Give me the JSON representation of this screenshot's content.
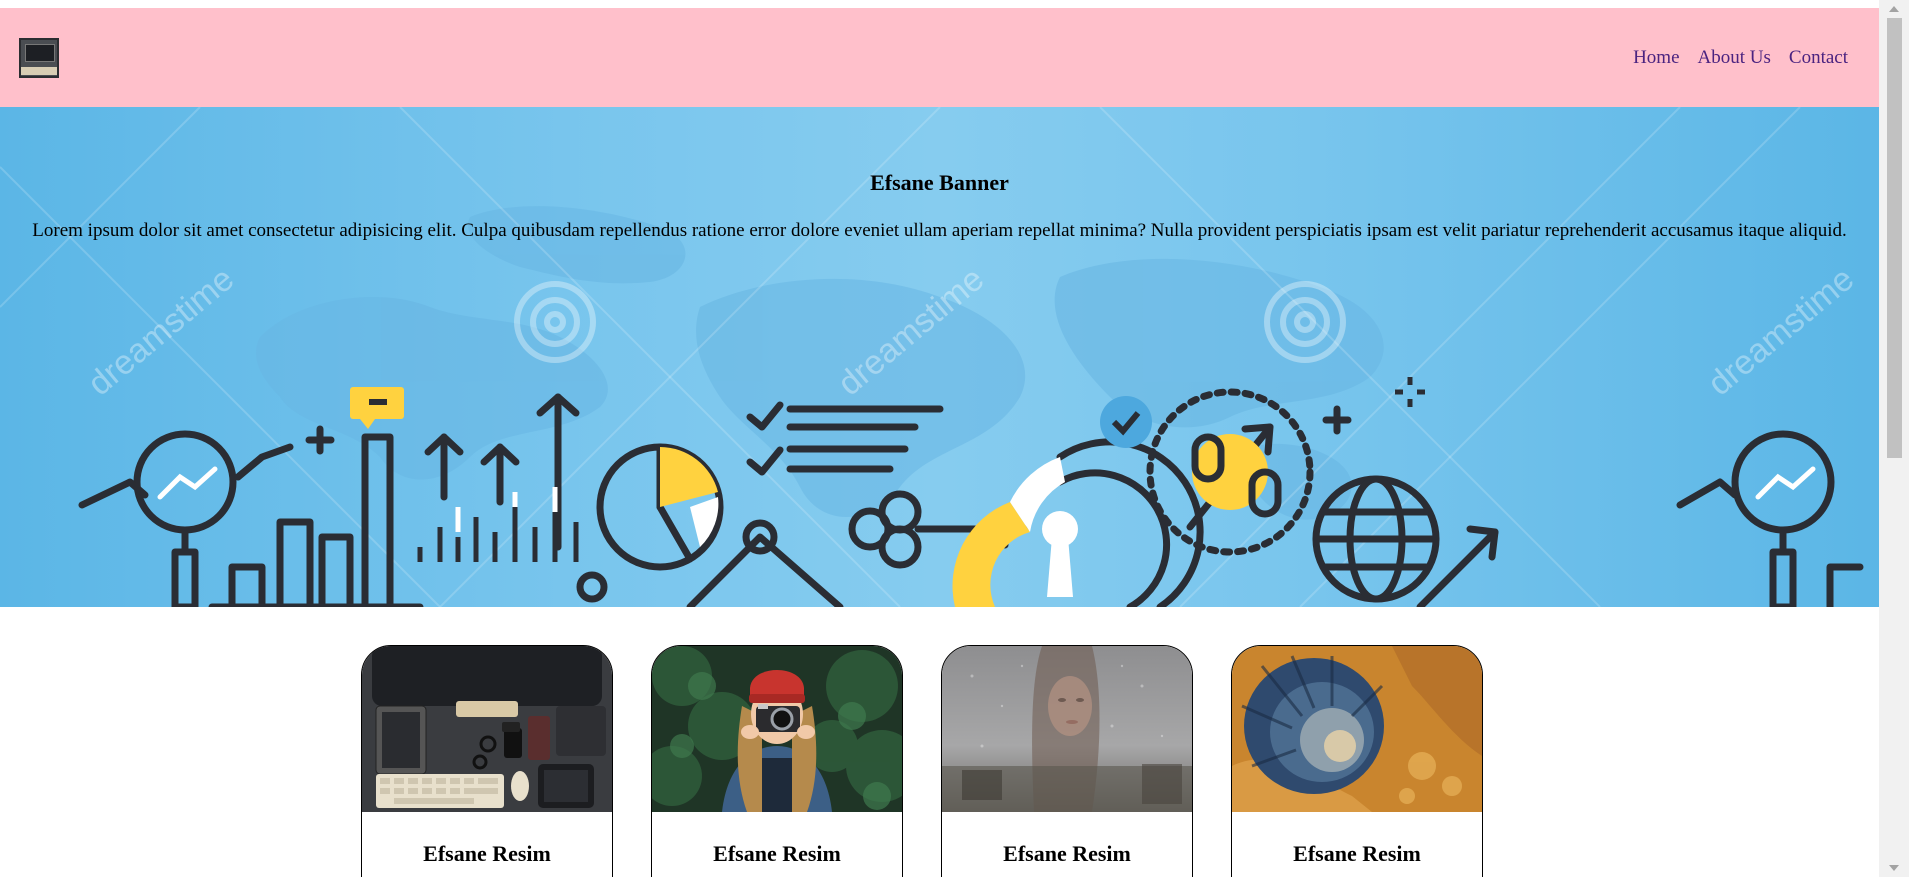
{
  "logo": {
    "icon": "workspace-logo-icon"
  },
  "nav": {
    "items": [
      "Home",
      "About Us",
      "Contact"
    ]
  },
  "banner": {
    "title": "Efsane Banner",
    "description": "Lorem ipsum dolor sit amet consectetur adipisicing elit. Culpa quibusdam repellendus ratione error dolore eveniet ullam aperiam repellat minima? Nulla provident perspiciatis ipsam est velit pariatur reprehenderit accusamus itaque aliquid.",
    "watermark": "dreamstime"
  },
  "cards": [
    {
      "title": "Efsane Resim",
      "image": "desk-workspace-photo"
    },
    {
      "title": "Efsane Resim",
      "image": "woman-with-camera-photo"
    },
    {
      "title": "Efsane Resim",
      "image": "woman-behind-rainy-glass-photo"
    },
    {
      "title": "Efsane Resim",
      "image": "crater-aerial-photo"
    }
  ],
  "colors": {
    "header_bg": "#ffc0cb",
    "nav_link": "#4b2380",
    "banner_bg": "#78c5ed",
    "accent_yellow": "#ffd23f",
    "line_dark": "#2a2d34"
  }
}
